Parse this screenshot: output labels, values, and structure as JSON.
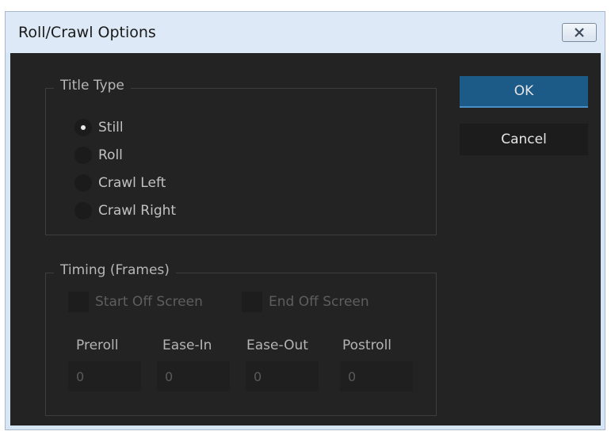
{
  "window": {
    "title": "Roll/Crawl Options"
  },
  "title_type": {
    "legend": "Title Type",
    "options": [
      {
        "label": "Still",
        "selected": true
      },
      {
        "label": "Roll",
        "selected": false
      },
      {
        "label": "Crawl Left",
        "selected": false
      },
      {
        "label": "Crawl Right",
        "selected": false
      }
    ]
  },
  "timing": {
    "legend": "Timing (Frames)",
    "start_off_screen_label": "Start Off Screen",
    "start_off_screen_checked": false,
    "end_off_screen_label": "End Off Screen",
    "end_off_screen_checked": false,
    "fields": [
      {
        "label": "Preroll",
        "value": "0"
      },
      {
        "label": "Ease-In",
        "value": "0"
      },
      {
        "label": "Ease-Out",
        "value": "0"
      },
      {
        "label": "Postroll",
        "value": "0"
      }
    ]
  },
  "buttons": {
    "ok_label": "OK",
    "cancel_label": "Cancel"
  },
  "colors": {
    "panel_bg": "#232323",
    "ok_button": "#1c5a87",
    "titlebar": "#dde9f6"
  }
}
